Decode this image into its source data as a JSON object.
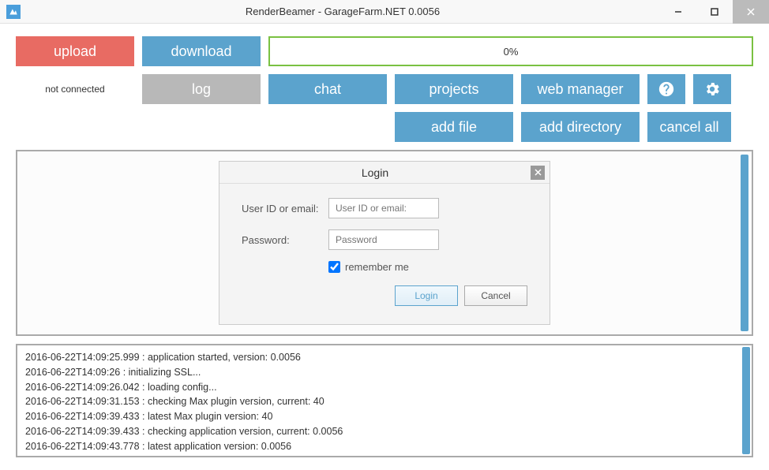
{
  "window": {
    "title": "RenderBeamer - GarageFarm.NET 0.0056"
  },
  "toolbar": {
    "upload": "upload",
    "download": "download",
    "progress": "0%",
    "status": "not connected",
    "log": "log",
    "chat": "chat",
    "projects": "projects",
    "web_manager": "web manager",
    "add_file": "add file",
    "add_directory": "add directory",
    "cancel_all": "cancel all"
  },
  "login": {
    "title": "Login",
    "user_label": "User ID or email:",
    "user_placeholder": "User ID or email:",
    "password_label": "Password:",
    "password_placeholder": "Password",
    "remember": "remember me",
    "login_btn": "Login",
    "cancel_btn": "Cancel"
  },
  "log_lines": [
    "2016-06-22T14:09:25.999 : application started, version: 0.0056",
    "2016-06-22T14:09:26 : initializing SSL...",
    "2016-06-22T14:09:26.042 : loading config...",
    "2016-06-22T14:09:31.153 : checking Max plugin version, current: 40",
    "2016-06-22T14:09:39.433 : latest Max plugin version: 40",
    "2016-06-22T14:09:39.433 : checking application version, current: 0.0056",
    "2016-06-22T14:09:43.778 : latest application version: 0.0056"
  ]
}
